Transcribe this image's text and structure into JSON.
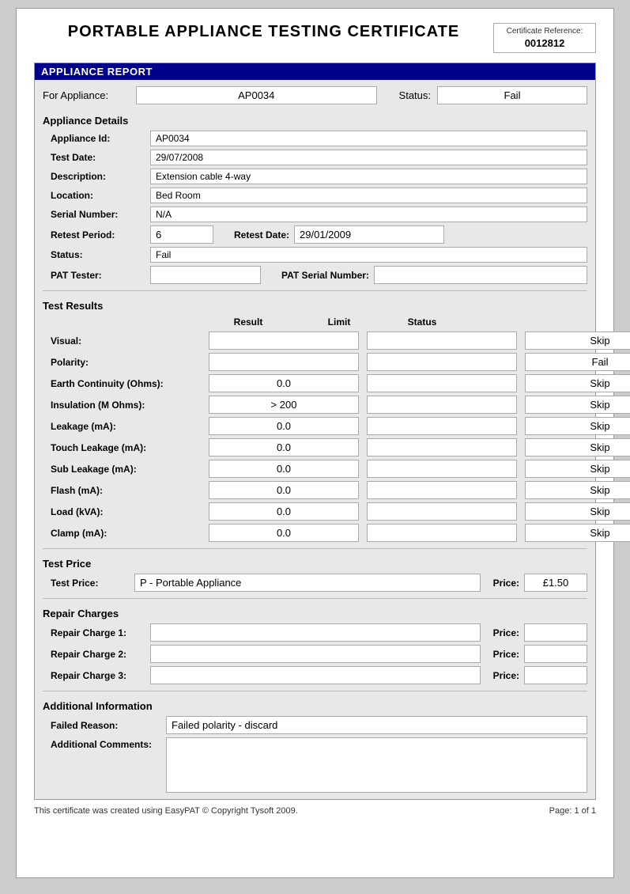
{
  "header": {
    "title": "PORTABLE APPLIANCE TESTING CERTIFICATE",
    "cert_ref_label": "Certificate Reference:",
    "cert_ref_number": "0012812"
  },
  "appliance_report": {
    "section_label": "APPLIANCE REPORT",
    "for_appliance_label": "For Appliance:",
    "appliance_id": "AP0034",
    "status_label": "Status:",
    "status_value": "Fail"
  },
  "appliance_details": {
    "section_title": "Appliance Details",
    "fields": [
      {
        "label": "Appliance Id:",
        "value": "AP0034"
      },
      {
        "label": "Test Date:",
        "value": "29/07/2008"
      },
      {
        "label": "Description:",
        "value": "Extension cable 4-way"
      },
      {
        "label": "Location:",
        "value": "Bed Room"
      },
      {
        "label": "Serial Number:",
        "value": "N/A"
      }
    ],
    "retest_period_label": "Retest Period:",
    "retest_period_value": "6",
    "retest_date_label": "Retest Date:",
    "retest_date_value": "29/01/2009",
    "status_label": "Status:",
    "status_value": "Fail",
    "pat_tester_label": "PAT Tester:",
    "pat_tester_value": "",
    "pat_serial_label": "PAT Serial Number:",
    "pat_serial_value": ""
  },
  "test_results": {
    "section_title": "Test Results",
    "col_result": "Result",
    "col_limit": "Limit",
    "col_status": "Status",
    "rows": [
      {
        "label": "Visual:",
        "result": "",
        "limit": "",
        "status": "Skip"
      },
      {
        "label": "Polarity:",
        "result": "",
        "limit": "",
        "status": "Fail"
      },
      {
        "label": "Earth Continuity (Ohms):",
        "result": "0.0",
        "limit": "",
        "status": "Skip"
      },
      {
        "label": "Insulation (M Ohms):",
        "result": "> 200",
        "limit": "",
        "status": "Skip"
      },
      {
        "label": "Leakage (mA):",
        "result": "0.0",
        "limit": "",
        "status": "Skip"
      },
      {
        "label": "Touch Leakage (mA):",
        "result": "0.0",
        "limit": "",
        "status": "Skip"
      },
      {
        "label": "Sub Leakage (mA):",
        "result": "0.0",
        "limit": "",
        "status": "Skip"
      },
      {
        "label": "Flash (mA):",
        "result": "0.0",
        "limit": "",
        "status": "Skip"
      },
      {
        "label": "Load (kVA):",
        "result": "0.0",
        "limit": "",
        "status": "Skip"
      },
      {
        "label": "Clamp (mA):",
        "result": "0.0",
        "limit": "",
        "status": "Skip"
      }
    ]
  },
  "test_price": {
    "section_title": "Test Price",
    "test_price_label": "Test Price:",
    "test_price_value": "P - Portable Appliance",
    "price_label": "Price:",
    "price_value": "£1.50"
  },
  "repair_charges": {
    "section_title": "Repair Charges",
    "rows": [
      {
        "label": "Repair Charge 1:",
        "value": "",
        "price_label": "Price:",
        "price_value": ""
      },
      {
        "label": "Repair Charge 2:",
        "value": "",
        "price_label": "Price:",
        "price_value": ""
      },
      {
        "label": "Repair Charge 3:",
        "value": "",
        "price_label": "Price:",
        "price_value": ""
      }
    ]
  },
  "additional_info": {
    "section_title": "Additional Information",
    "failed_reason_label": "Failed Reason:",
    "failed_reason_value": "Failed polarity - discard",
    "additional_comments_label": "Additional Comments:",
    "additional_comments_value": ""
  },
  "footer": {
    "left": "This certificate was created using EasyPAT © Copyright Tysoft 2009.",
    "right": "Page: 1 of 1"
  }
}
